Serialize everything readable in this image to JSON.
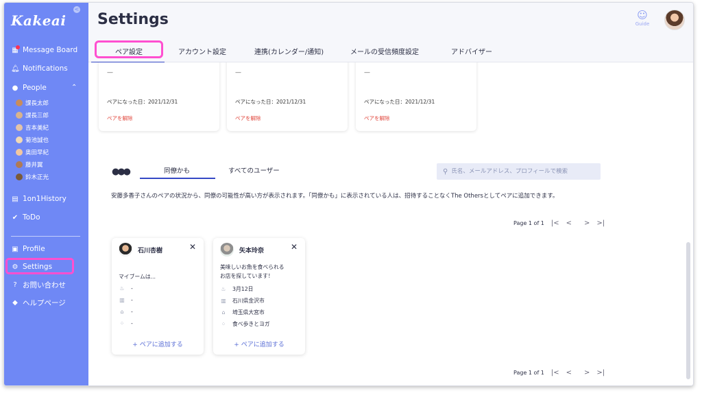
{
  "app": {
    "logo": "Kakeai",
    "collapse_icon": "<"
  },
  "sidebar": {
    "message_board": "Message Board",
    "notifications": "Notifications",
    "people": "People",
    "people_members": [
      "課長太郎",
      "課長三郎",
      "吉本美紀",
      "菊池誠也",
      "奥田早紀",
      "藤井翼",
      "鈴木正光"
    ],
    "history": "1on1History",
    "todo": "ToDo",
    "profile": "Profile",
    "settings": "Settings",
    "contact": "お問い合わせ",
    "help": "ヘルプページ"
  },
  "header": {
    "title": "Settings",
    "guide_label": "Guide",
    "tabs": [
      "ペア設定",
      "アカウント設定",
      "連携(カレンダー/通知)",
      "メールの受信頻度設定",
      "アドバイザー"
    ]
  },
  "pairs": [
    {
      "dash": "—",
      "date": "ペアになった日：2021/12/31",
      "unpair": "ペアを解除"
    },
    {
      "dash": "—",
      "date": "ペアになった日：2021/12/31",
      "unpair": "ペアを解除"
    },
    {
      "dash": "—",
      "date": "ペアになった日：2021/12/31",
      "unpair": "ペアを解除"
    }
  ],
  "candidates_section": {
    "subtabs": [
      "同僚かも",
      "すべてのユーザー"
    ],
    "search_placeholder": "氏名、メールアドレス、プロフィールで検索",
    "description": "安藤多香子さんのペアの状況から、同僚の可能性が高い方が表示されます。「同僚かも」に表示されている人は、招待することなくThe Othersとしてペアに追加できます。",
    "pager_text": "Page 1 of 1",
    "pager_first": "|<",
    "pager_prev": "<",
    "pager_next": ">",
    "pager_last": ">|"
  },
  "candidates": [
    {
      "name": "石川杏樹",
      "bio_lines": [
        "マイブームは..."
      ],
      "birthday": "-",
      "location": "-",
      "hometown": "-",
      "hobby": "-",
      "add_label": "+ ペアに追加する",
      "close": "✕"
    },
    {
      "name": "矢本玲奈",
      "bio_lines": [
        "美味しいお魚を食べられる",
        "お店を探しています！"
      ],
      "birthday": "3月12日",
      "location": "石川県金沢市",
      "hometown": "埼玉県大宮市",
      "hobby": "食べ歩きとヨガ",
      "add_label": "+ ペアに追加する",
      "close": "✕"
    }
  ],
  "colors": {
    "sidebar": "#6f88f5",
    "accent": "#3448c5",
    "highlight": "#ff4fd0",
    "danger": "#e0453b"
  }
}
